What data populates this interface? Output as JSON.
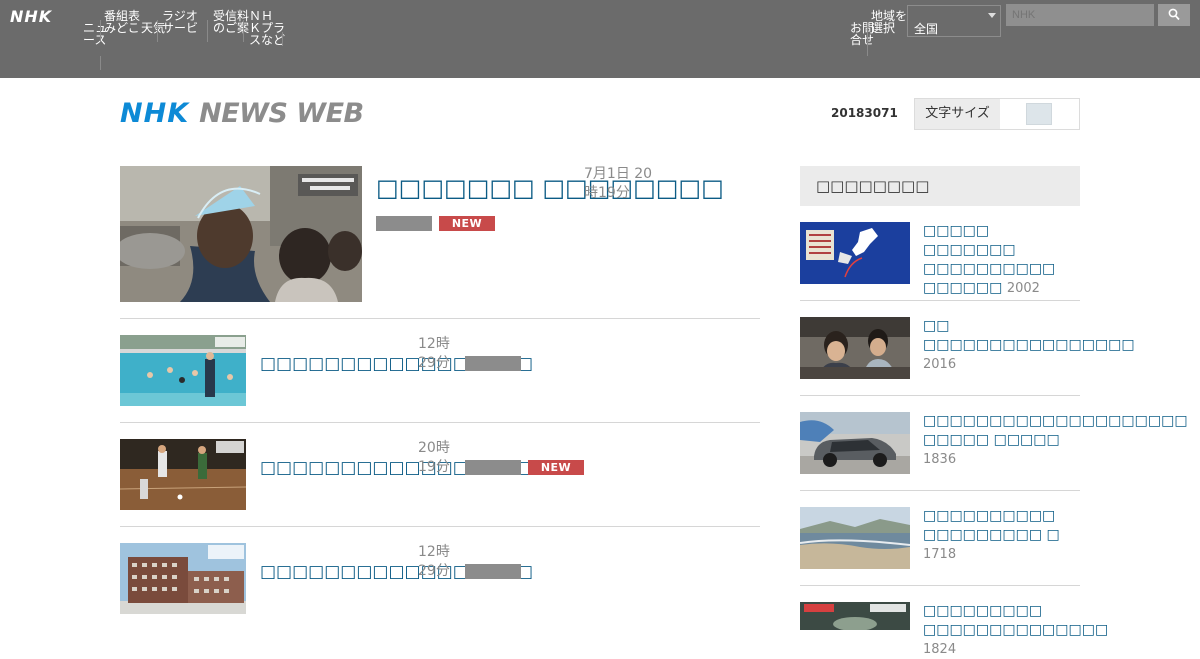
{
  "topnav": {
    "brand": "NHK",
    "items": [
      "ニュ\nース",
      "番組表\nみどこ",
      "天気",
      "ラジオ\nサービ",
      "受信料\nのご案",
      "ＮＨ\nＫプラ\nスなど"
    ],
    "right_items": [
      "お問\n合せ",
      "地域を\n選択"
    ],
    "region_value": "全国",
    "search_placeholder": "NHK"
  },
  "header": {
    "logo_primary": "NHK",
    "logo_secondary": "NEWS WEB",
    "date": "20183071",
    "toggle_label": "文字サイズ"
  },
  "main_articles": [
    {
      "title": "□□□□□□□ □□□□□□□□",
      "date": "7月1日 20\n時19分",
      "is_new": true,
      "new_label": "NEW"
    },
    {
      "title": "□□□□□□□□□□□□□□□□□",
      "date": "12時\n29分",
      "is_new": false,
      "new_label": ""
    },
    {
      "title": "□□□□□□□□□□□□□□□□□",
      "date": "20時\n19分",
      "is_new": true,
      "new_label": "NEW"
    },
    {
      "title": "□□□□□□□□□□□□□□□□□",
      "date": "12時\n29分",
      "is_new": false,
      "new_label": ""
    }
  ],
  "ranking": {
    "heading": "□□□□□□□□",
    "items": [
      {
        "title": "□□□□□ □□□□□□□ □□□□□□□□□□ □□□□□□ ",
        "count": "2002"
      },
      {
        "title": "□□ □□□□□□□□□□□□□□□□ ",
        "count": "2016"
      },
      {
        "title": "□□□□□□□□□□□□□□□□□□□□ □□□□□ □□□□□ ",
        "count": "1836"
      },
      {
        "title": "□□□□□□□□□□ □□□□□□□□□ □ ",
        "count": "1718"
      },
      {
        "title": "□□□□□□□□□ □□□□□□□□□□□□□□ ",
        "count": "1824"
      }
    ]
  },
  "colors": {
    "topbar": "#6b6b6b",
    "link": "#0b5b85",
    "new_badge": "#c84a4a",
    "brand_blue": "#0d8ad6"
  }
}
